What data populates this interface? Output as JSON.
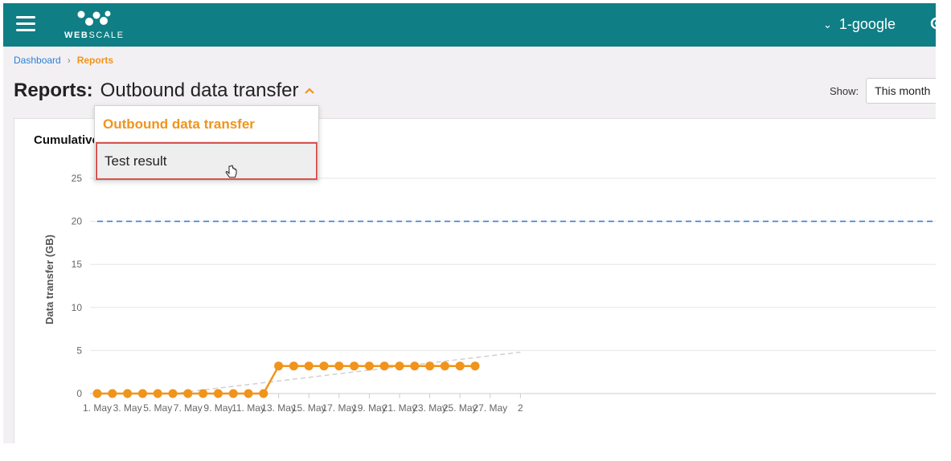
{
  "header": {
    "logo_text_bold": "WEB",
    "logo_text_light": "SCALE",
    "account_name": "1-google",
    "colors": {
      "bar": "#0f7e85"
    }
  },
  "breadcrumb": {
    "home": "Dashboard",
    "current": "Reports"
  },
  "page": {
    "title_label": "Reports:",
    "report_selected": "Outbound data transfer",
    "show_label": "Show:",
    "period": "This month"
  },
  "dropdown": {
    "options": [
      "Outbound data transfer",
      "Test result"
    ]
  },
  "card": {
    "title": "Cumulative"
  },
  "chart_data": {
    "type": "line",
    "ylabel": "Data transfer (GB)",
    "ylim": [
      0,
      25
    ],
    "yticks": [
      "0",
      "5",
      "10",
      "15",
      "20",
      "25"
    ],
    "xticks": [
      "1. May",
      "3. May",
      "5. May",
      "7. May",
      "9. May",
      "11. May",
      "13. May",
      "15. May",
      "17. May",
      "19. May",
      "21. May",
      "23. May",
      "25. May",
      "27. May",
      "2"
    ],
    "series": [
      {
        "color": "#f0941c",
        "days": [
          1,
          2,
          3,
          4,
          5,
          6,
          7,
          8,
          9,
          10,
          11,
          12,
          13,
          14,
          15,
          16,
          17,
          18,
          19,
          20,
          21,
          22,
          23,
          24,
          25,
          26
        ],
        "values": [
          0,
          0,
          0,
          0,
          0,
          0,
          0,
          0,
          0,
          0,
          0,
          0,
          3.2,
          3.2,
          3.2,
          3.2,
          3.2,
          3.2,
          3.2,
          3.2,
          3.2,
          3.2,
          3.2,
          3.2,
          3.2,
          3.2
        ]
      },
      {
        "color": "#3b7dd8",
        "style": "dashed",
        "value": 20
      },
      {
        "color": "#d0d0d0",
        "style": "dashed",
        "from": [
          6,
          0
        ],
        "to": [
          29,
          4.8
        ]
      }
    ]
  }
}
